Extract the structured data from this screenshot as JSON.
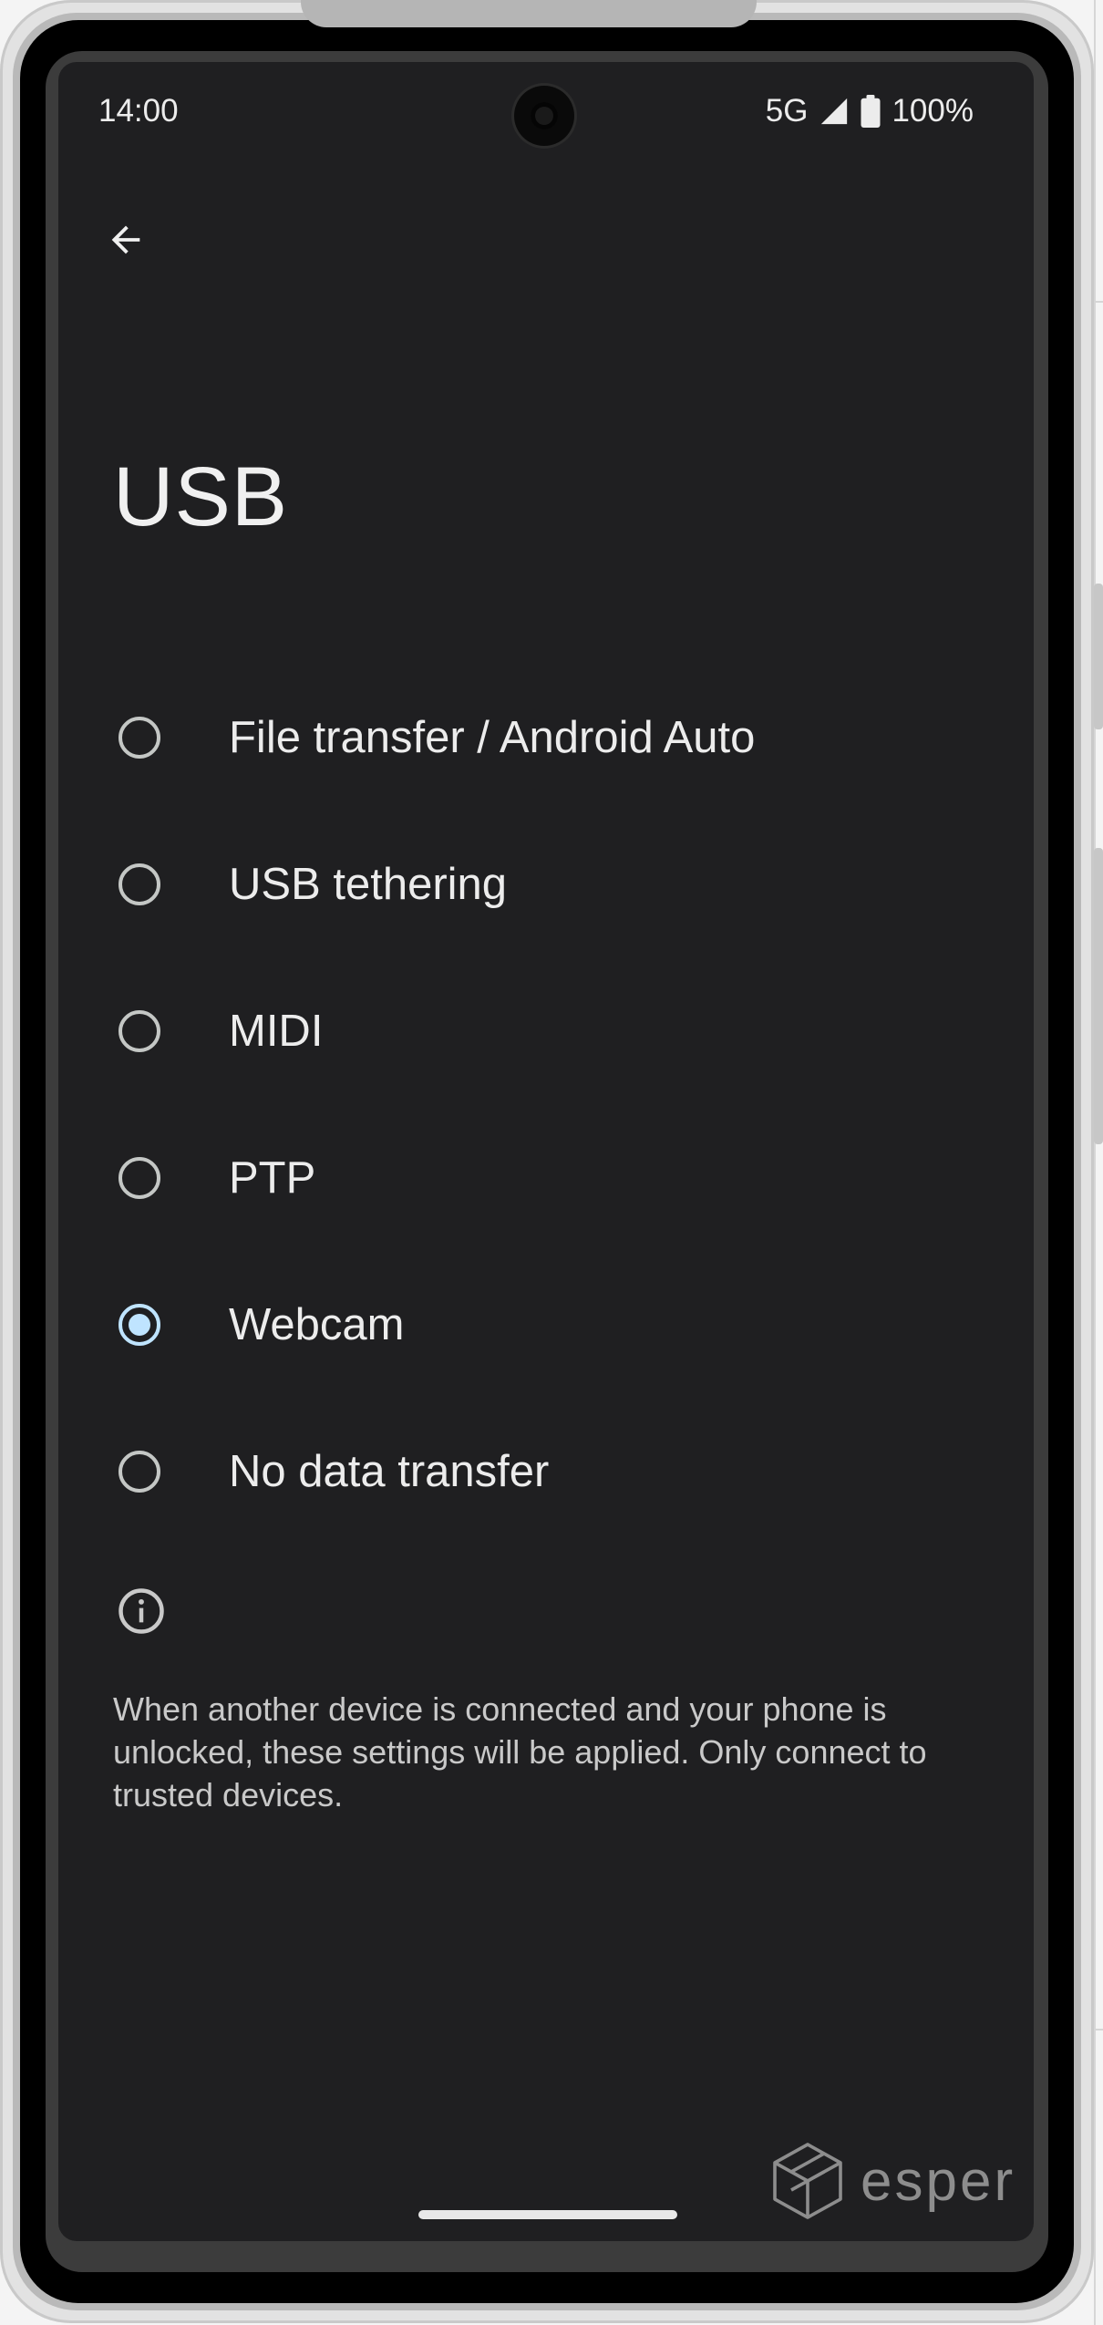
{
  "status_bar": {
    "time": "14:00",
    "network": "5G",
    "battery": "100%"
  },
  "header": {
    "back_icon": "arrow-back-icon",
    "title": "USB"
  },
  "options": [
    {
      "label": "File transfer / Android Auto",
      "selected": false
    },
    {
      "label": "USB tethering",
      "selected": false
    },
    {
      "label": "MIDI",
      "selected": false
    },
    {
      "label": "PTP",
      "selected": false
    },
    {
      "label": "Webcam",
      "selected": true
    },
    {
      "label": "No data transfer",
      "selected": false
    }
  ],
  "info": {
    "icon": "info-icon",
    "text": "When another device is connected and your phone is unlocked, these settings will be applied. Only connect to trusted devices."
  },
  "watermark": {
    "text": "esper"
  },
  "colors": {
    "background": "#1f1f21",
    "text": "#ececec",
    "radio_selected": "#bfe4ff",
    "radio_unselected": "#c4c7c5"
  }
}
